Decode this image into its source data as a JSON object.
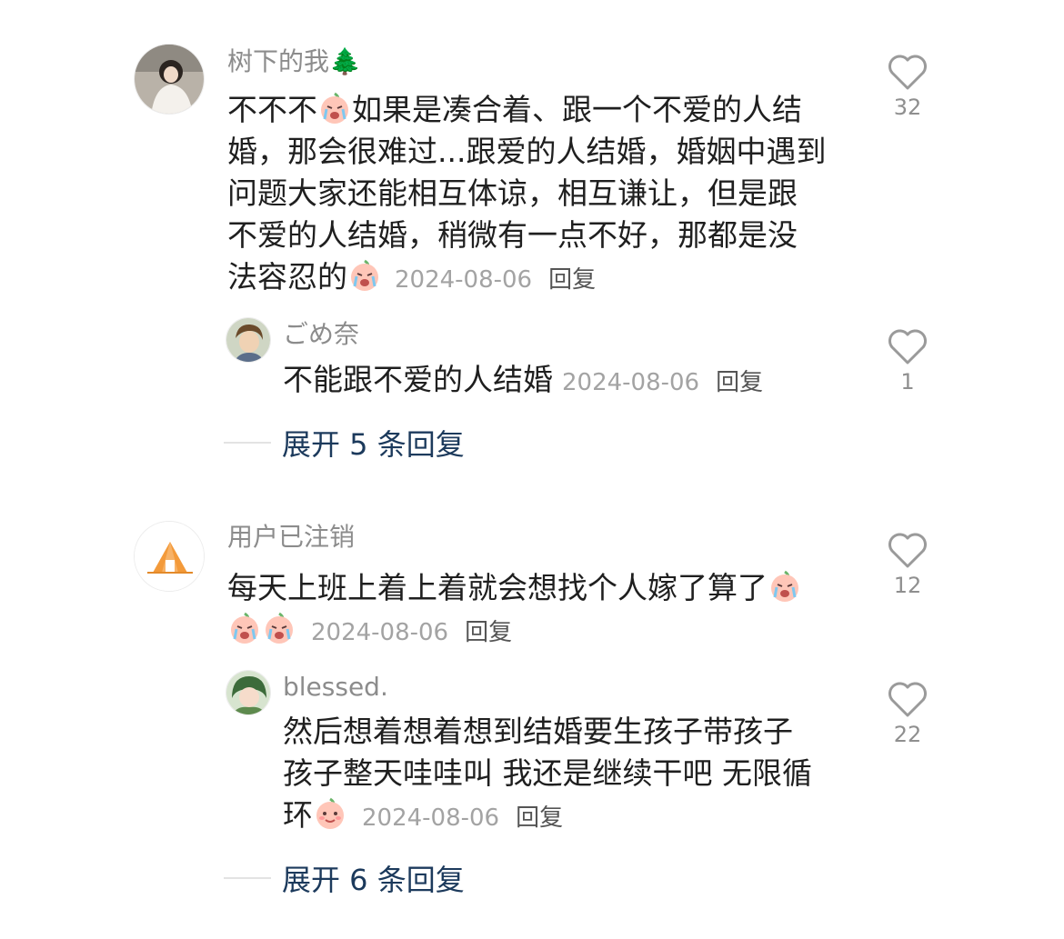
{
  "threads": [
    {
      "comment": {
        "username": "树下的我🌲",
        "lines": [
          "不不不",
          "如果是凑合着、跟一个不爱的人结",
          "婚，那会很难过...跟爱的人结婚，婚姻中遇到",
          "问题大家还能相互体谅，相互谦让，但是跟",
          "不爱的人结婚，稍微有一点不好，那都是没",
          "法容忍的"
        ],
        "date": "2024-08-06",
        "reply_label": "回复",
        "likes": "32"
      },
      "reply": {
        "username": "ごめ奈",
        "text": "不能跟不爱的人结婚",
        "date": "2024-08-06",
        "reply_label": "回复",
        "likes": "1"
      },
      "expand_label": "展开 5 条回复"
    },
    {
      "comment": {
        "username": "用户已注销",
        "lines": [
          "每天上班上着上着就会想找个人嫁了算了"
        ],
        "date": "2024-08-06",
        "reply_label": "回复",
        "likes": "12"
      },
      "reply": {
        "username": "blessed.",
        "lines": [
          "然后想着想着想到结婚要生孩子带孩子",
          "孩子整天哇哇叫 我还是继续干吧 无限循",
          "环"
        ],
        "date": "2024-08-06",
        "reply_label": "回复",
        "likes": "22"
      },
      "expand_label": "展开 6 条回复"
    }
  ],
  "icons": {
    "like": "heart-outline-icon",
    "emoji_crying": "crying-peach-emoji",
    "emoji_smile": "smiling-peach-emoji"
  },
  "colors": {
    "expand_link": "#1c3a5c",
    "meta": "#a3a3a3",
    "username": "#8c8c8c"
  }
}
